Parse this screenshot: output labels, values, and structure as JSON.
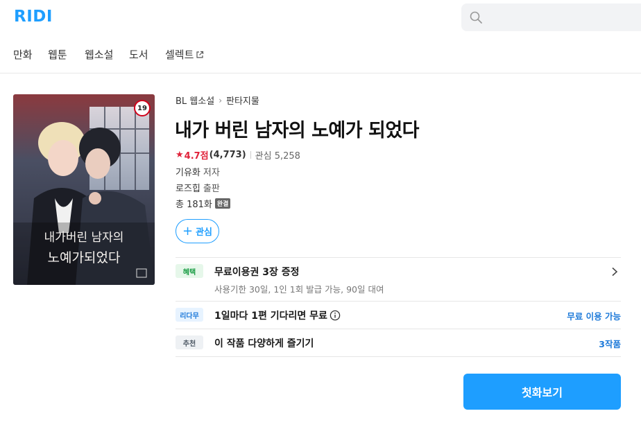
{
  "header": {
    "logo": "RIDI",
    "search_placeholder": ""
  },
  "nav": {
    "items": [
      {
        "label": "만화"
      },
      {
        "label": "웹툰"
      },
      {
        "label": "웹소설"
      },
      {
        "label": "도서"
      },
      {
        "label": "셀렉트"
      }
    ]
  },
  "book": {
    "cover": {
      "age_rating": "19",
      "cover_title": "내가 버린 남자의 노예가 되었다"
    },
    "breadcrumb": {
      "category": "BL 웹소설",
      "genre": "판타지물"
    },
    "title": "내가 버린 남자의 노예가 되었다",
    "rating": {
      "score": "4.7점",
      "count": "(4,773)",
      "favorites": "관심 5,258"
    },
    "author": {
      "name": "기유화",
      "role": "저자"
    },
    "publisher": {
      "name": "로즈힙",
      "role": "출판"
    },
    "episodes": {
      "count": "총 181화",
      "status": "완결"
    },
    "favorite_button": "관심"
  },
  "benefits": {
    "rows": [
      {
        "tag": "혜택",
        "title": "무료이용권 3장 증정",
        "subtitle": "사용기한 30일, 1인 1회 발급 가능, 90일 대여"
      },
      {
        "tag": "리다무",
        "title": "1일마다 1편 기다리면 무료",
        "right": "무료 이용 가능"
      },
      {
        "tag": "추천",
        "title": "이 작품 다양하게 즐기기",
        "right": "3작품"
      }
    ]
  },
  "cta": {
    "label": "첫화보기"
  },
  "colors": {
    "brand": "#1e9eff",
    "rating": "#e0223a",
    "tag_green": "#1a9c44",
    "tag_blue": "#1e7ad9"
  }
}
